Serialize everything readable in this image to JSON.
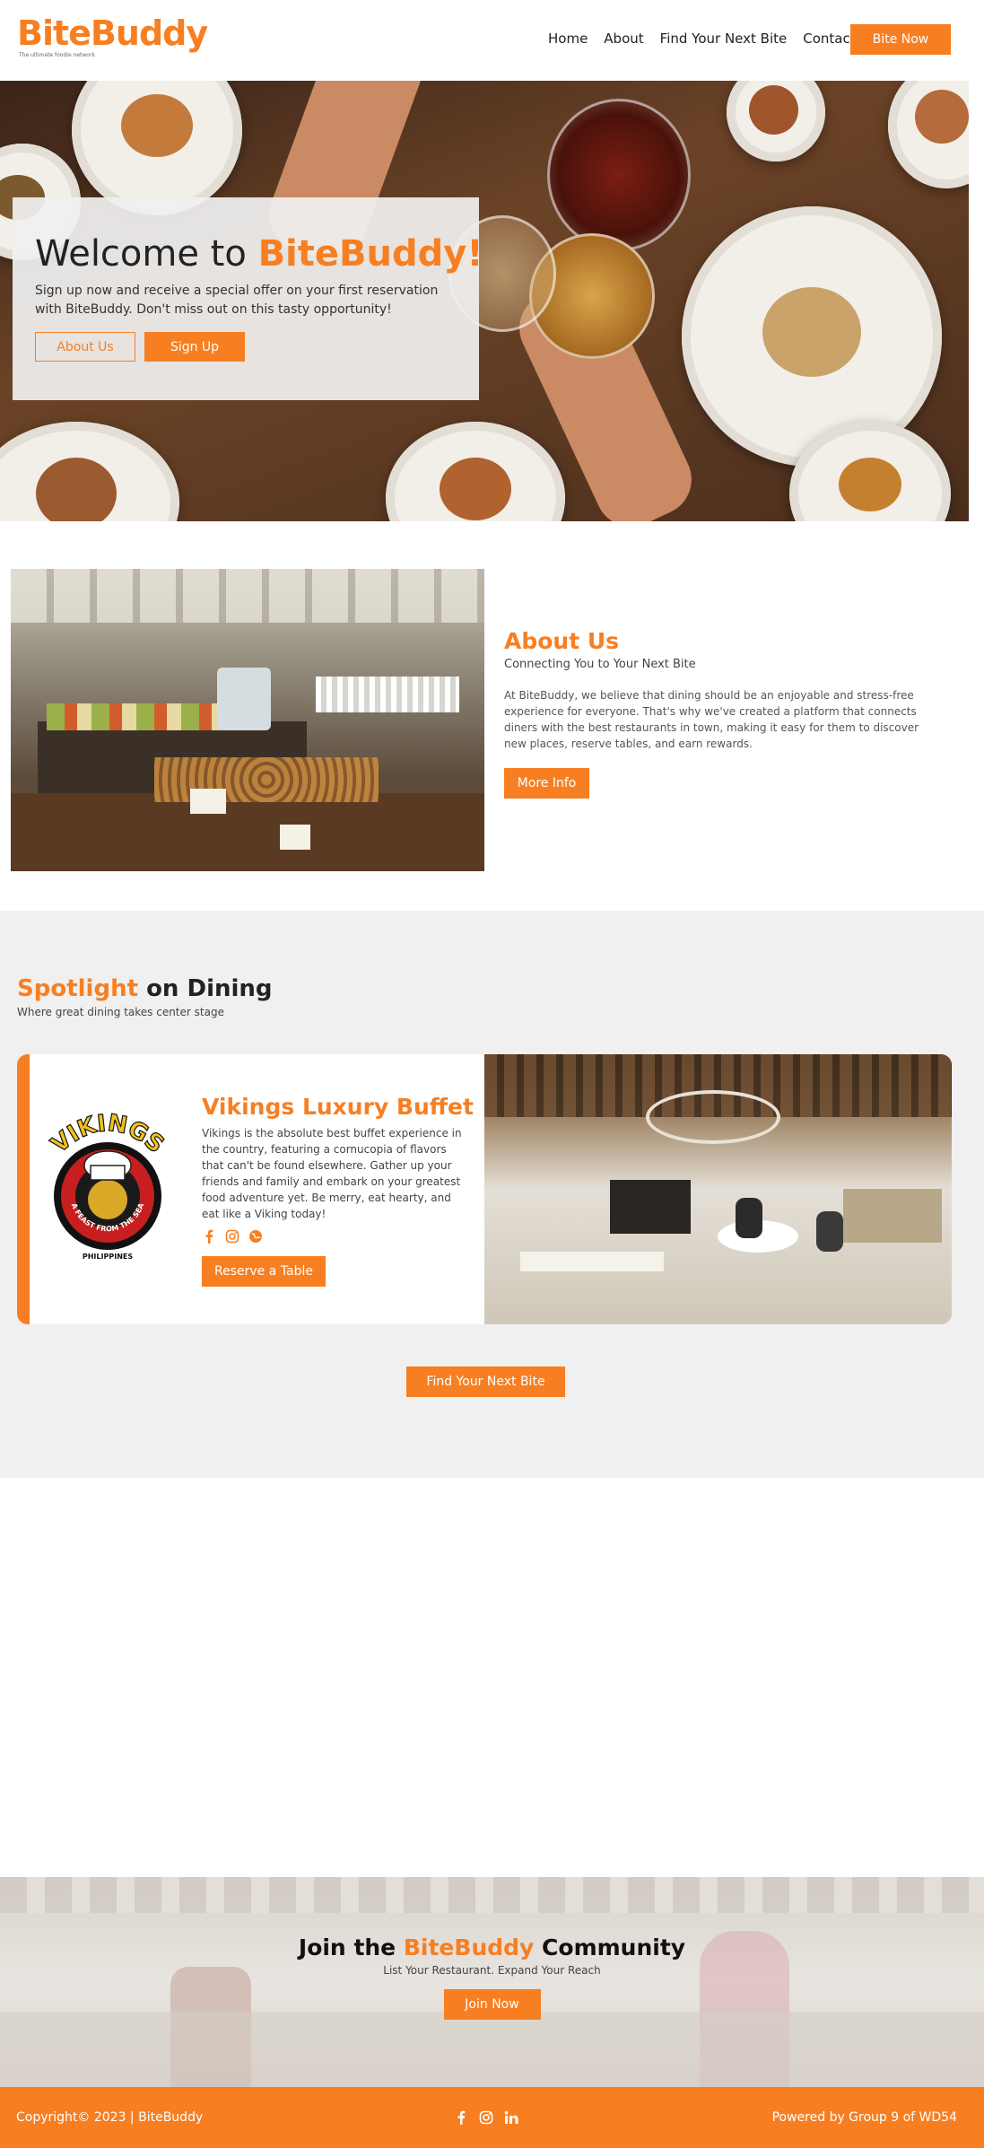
{
  "brand": {
    "name": "BiteBuddy",
    "tagline": "The ultimate foodie network"
  },
  "nav": {
    "links": [
      "Home",
      "About",
      "Find Your Next Bite",
      "Contact"
    ],
    "cta": "Bite Now"
  },
  "hero": {
    "title_prefix": "Welcome to ",
    "title_brand": "BiteBuddy!",
    "subtitle": "Sign up now and receive a special offer on your first reservation with BiteBuddy. Don't miss out on this tasty opportunity!",
    "btn_about": "About Us",
    "btn_signup": "Sign Up"
  },
  "about": {
    "heading": "About Us",
    "tagline": "Connecting You to Your Next Bite",
    "body": "At BiteBuddy, we believe that dining should be an enjoyable and stress-free experience for everyone. That's why we've created a platform that connects diners with the best restaurants in town, making it easy for them to discover new places, reserve tables, and earn rewards.",
    "button": "More Info"
  },
  "spotlight": {
    "heading_accent": "Spotlight",
    "heading_rest": " on Dining",
    "subtitle": "Where great dining takes center stage",
    "card": {
      "name": "Vikings Luxury Buffet",
      "logo_text": "VIKINGS",
      "logo_ring": "A FEAST FROM THE SEA",
      "logo_country": "PHILIPPINES",
      "description": "Vikings is the absolute best buffet experience in the country, featuring a cornucopia of flavors that can't be found elsewhere. Gather up your friends and family and embark on your greatest food adventure yet. Be merry, eat hearty, and eat like a Viking today!",
      "icons": [
        "facebook-icon",
        "instagram-icon",
        "globe-icon"
      ],
      "button": "Reserve a Table"
    },
    "cta": "Find Your Next Bite"
  },
  "join": {
    "prefix": "Join the ",
    "brand": "BiteBuddy",
    "suffix": " Community",
    "tagline": "List Your Restaurant. Expand Your Reach",
    "button": "Join Now"
  },
  "footer": {
    "copyright": "Copyright© 2023 | BiteBuddy",
    "social": [
      "facebook-icon",
      "instagram-icon",
      "linkedin-icon"
    ],
    "powered": "Powered by Group 9 of WD54"
  },
  "colors": {
    "accent": "#f77f22",
    "section_bg": "#f0f0f0"
  }
}
